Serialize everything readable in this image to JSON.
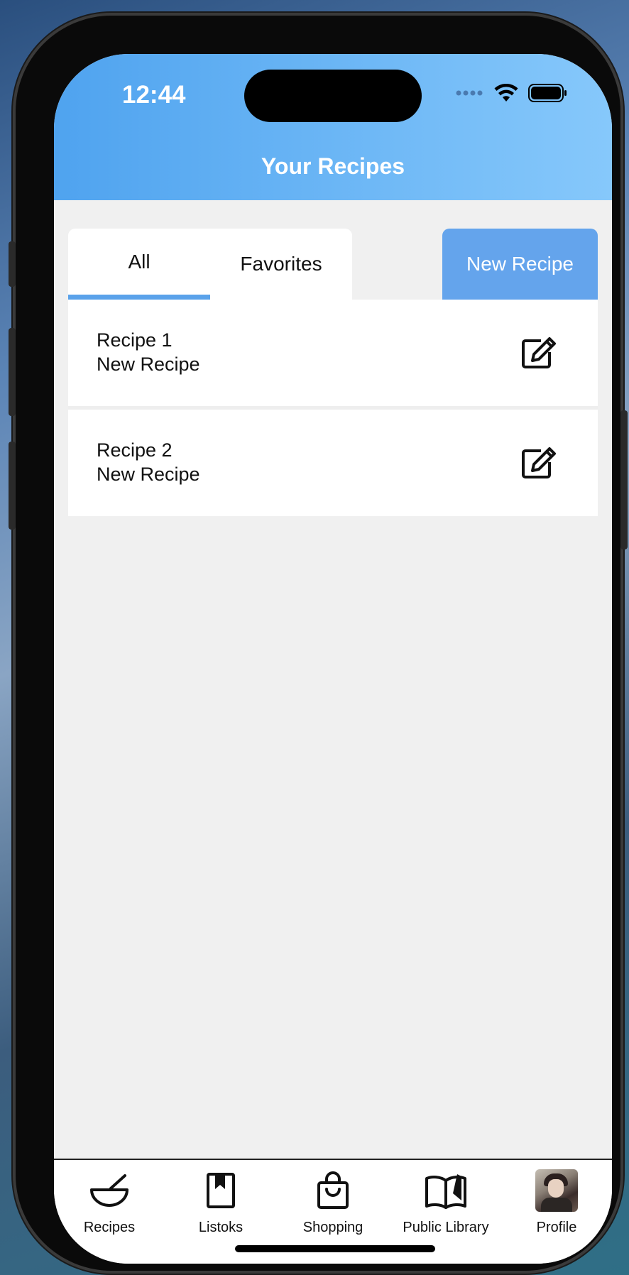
{
  "status_bar": {
    "time": "12:44"
  },
  "header": {
    "title": "Your Recipes"
  },
  "tabs": [
    {
      "label": "All",
      "active": true
    },
    {
      "label": "Favorites",
      "active": false
    }
  ],
  "new_recipe_button": {
    "label": "New Recipe"
  },
  "recipes": [
    {
      "name": "Recipe 1",
      "subtitle": "New Recipe"
    },
    {
      "name": "Recipe 2",
      "subtitle": "New Recipe"
    }
  ],
  "tab_bar": {
    "items": [
      {
        "label": "Recipes",
        "icon": "bowl-icon"
      },
      {
        "label": "Listoks",
        "icon": "book-bookmark-icon"
      },
      {
        "label": "Shopping",
        "icon": "shopping-bag-icon"
      },
      {
        "label": "Public Library",
        "icon": "open-book-icon"
      },
      {
        "label": "Profile",
        "icon": "avatar"
      }
    ]
  },
  "colors": {
    "header_gradient_start": "#4fa3ef",
    "header_gradient_end": "#86c8fb",
    "accent": "#5aa2ea",
    "button": "#64a4ec",
    "background": "#f0f0f0"
  }
}
